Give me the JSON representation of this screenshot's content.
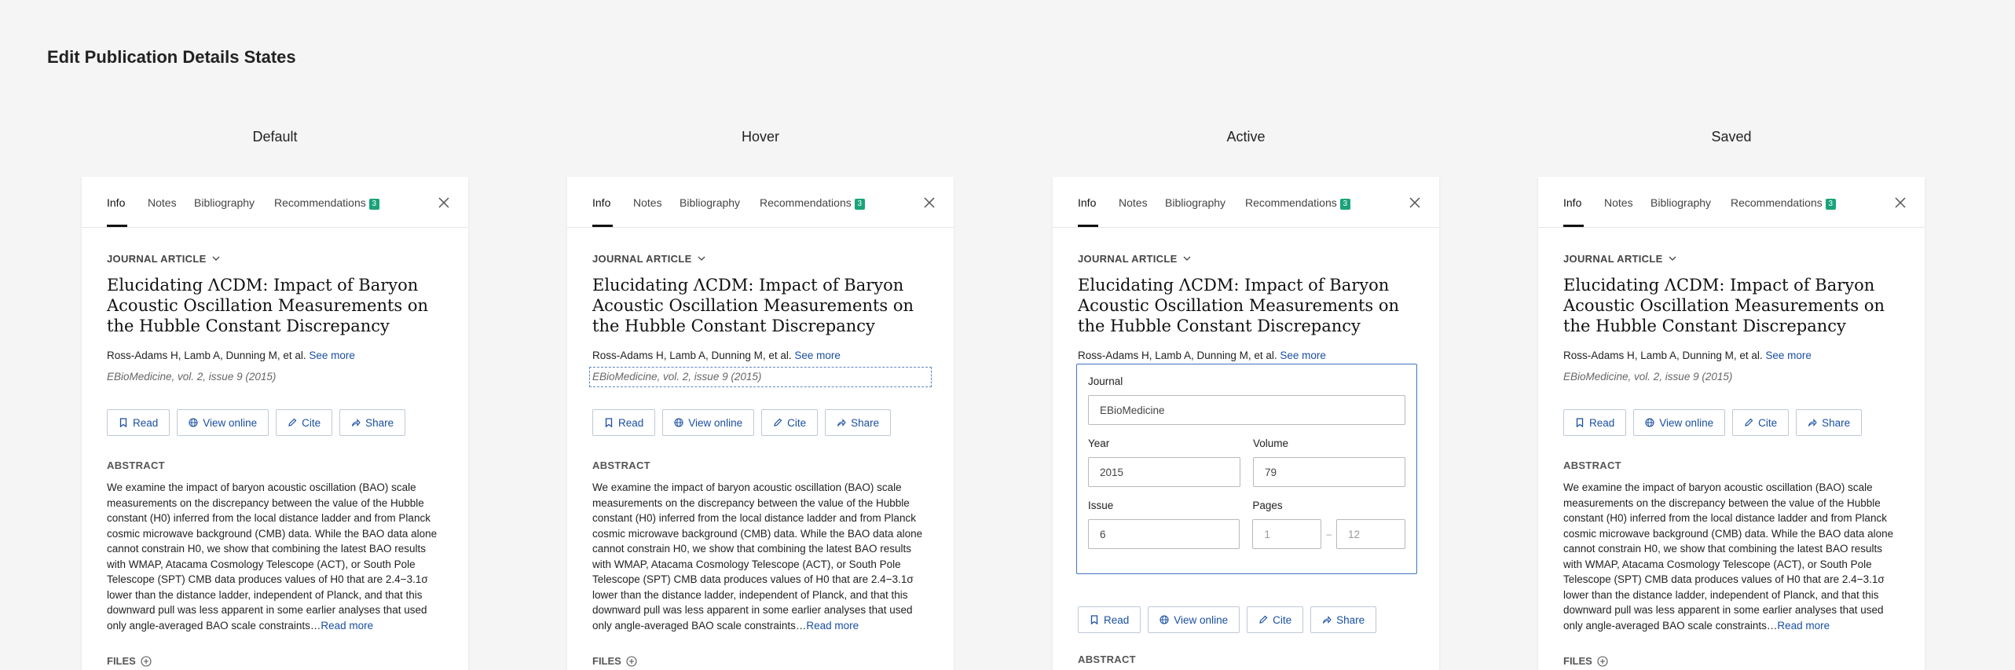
{
  "page_title": "Edit Publication Details States",
  "panels": [
    {
      "state": "Default"
    },
    {
      "state": "Hover"
    },
    {
      "state": "Active"
    },
    {
      "state": "Saved"
    }
  ],
  "tabs": {
    "info": "Info",
    "notes": "Notes",
    "bibliography": "Bibliography",
    "recommendations": "Recommendations",
    "recommendations_count": "3"
  },
  "article": {
    "type": "JOURNAL ARTICLE",
    "title": "Elucidating ΛCDM: Impact of Baryon Acoustic Oscillation Measurements on the Hubble Constant Discrepancy",
    "authors": "Ross-Adams H, Lamb A, Dunning M, et al.",
    "see_more": "See more",
    "journal": "EBioMedicine, vol. 2, issue 9 (2015)",
    "abstract_label": "ABSTRACT",
    "abstract": "We examine the impact of baryon acoustic oscillation (BAO) scale measurements on the discrepancy between the value of the Hubble constant (H0) inferred from the local distance ladder and from Planck cosmic microwave background (CMB) data. While the BAO data alone cannot constrain H0, we show that combining the latest BAO results with WMAP, Atacama Cosmology Telescope (ACT), or South Pole Telescope (SPT) CMB data produces values of H0 that are 2.4−3.1σ lower than the distance ladder, independent of Planck, and that this downward pull was less apparent in some earlier analyses that used only angle-averaged BAO scale constraints…",
    "read_more": "Read more",
    "files_label": "FILES"
  },
  "actions": {
    "read": "Read",
    "view_online": "View online",
    "cite": "Cite",
    "share": "Share"
  },
  "edit_form": {
    "journal_label": "Journal",
    "journal_value": "EBioMedicine",
    "year_label": "Year",
    "year_value": "2015",
    "volume_label": "Volume",
    "volume_value": "79",
    "issue_label": "Issue",
    "issue_value": "6",
    "pages_label": "Pages",
    "pages_start": "1",
    "pages_end": "12",
    "pages_separator": "–"
  }
}
